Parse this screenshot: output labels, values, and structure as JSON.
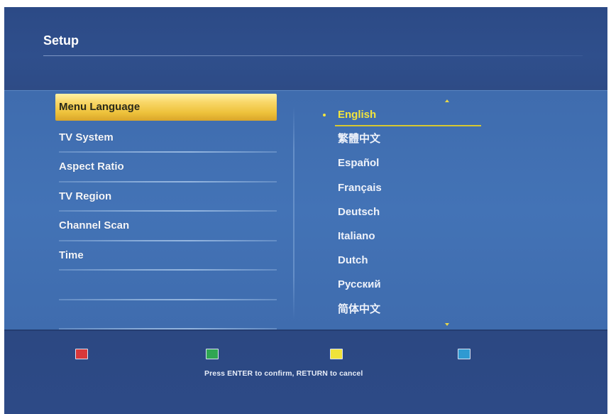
{
  "header": {
    "title": "Setup"
  },
  "menu": {
    "items": [
      {
        "label": "Menu Language",
        "selected": true
      },
      {
        "label": "TV System"
      },
      {
        "label": "Aspect Ratio"
      },
      {
        "label": "TV Region"
      },
      {
        "label": "Channel Scan"
      },
      {
        "label": "Time"
      },
      {
        "label": ""
      },
      {
        "label": ""
      }
    ]
  },
  "languages": {
    "items": [
      {
        "label": "English",
        "selected": true
      },
      {
        "label": "繁體中文"
      },
      {
        "label": "Español"
      },
      {
        "label": "Français"
      },
      {
        "label": "Deutsch"
      },
      {
        "label": "Italiano"
      },
      {
        "label": "Dutch"
      },
      {
        "label": "Русский"
      },
      {
        "label": "简体中文"
      }
    ]
  },
  "footer": {
    "keys": [
      "red",
      "green",
      "yellow",
      "blue"
    ],
    "hint": "Press ENTER to confirm, RETURN to cancel"
  },
  "colors": {
    "background": "#2f4d86",
    "panel": "#4373b6",
    "highlight": "#f9d86a",
    "selected_text": "#f3e53c",
    "key_red": "#d8383a",
    "key_green": "#2fa652",
    "key_yellow": "#f0e23a",
    "key_blue": "#2f9ad2"
  }
}
